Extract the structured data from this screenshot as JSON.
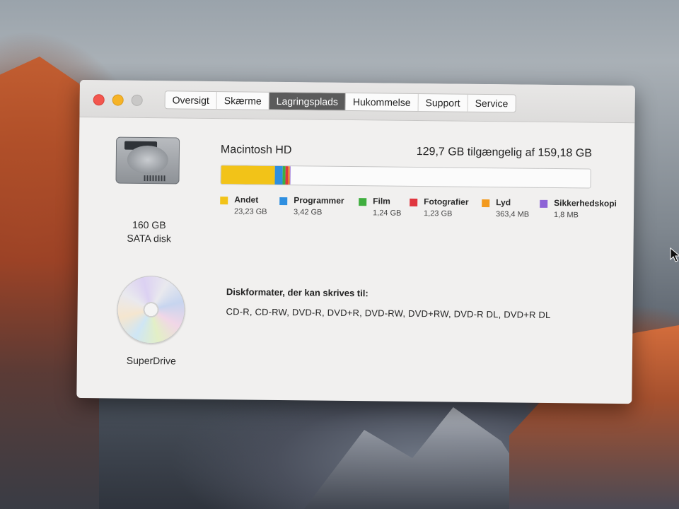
{
  "tabs": [
    "Oversigt",
    "Skærme",
    "Lagringsplads",
    "Hukommelse",
    "Support",
    "Service"
  ],
  "active_tab": "Lagringsplads",
  "disks": {
    "hdd": {
      "size": "160 GB",
      "type": "SATA disk"
    },
    "optical": {
      "name": "SuperDrive"
    }
  },
  "volume": {
    "name": "Macintosh HD",
    "available_text": "129,7 GB tilgængelig af 159,18 GB",
    "total_gb": 159.18,
    "available_gb": 129.7
  },
  "storage_categories": [
    {
      "name": "Andet",
      "size": "23,23 GB",
      "gb": 23.23,
      "color": "#f2c318"
    },
    {
      "name": "Programmer",
      "size": "3,42 GB",
      "gb": 3.42,
      "color": "#2f8fe0"
    },
    {
      "name": "Film",
      "size": "1,24 GB",
      "gb": 1.24,
      "color": "#3fae3f"
    },
    {
      "name": "Fotografier",
      "size": "1,23 GB",
      "gb": 1.23,
      "color": "#e0363f"
    },
    {
      "name": "Lyd",
      "size": "363,4 MB",
      "gb": 0.3634,
      "color": "#f39a1e"
    },
    {
      "name": "Sikkerhedskopi",
      "size": "1,8 MB",
      "gb": 0.0018,
      "color": "#8d63d6"
    }
  ],
  "optical_formats": {
    "title": "Diskformater, der kan skrives til:",
    "list": "CD-R, CD-RW, DVD-R, DVD+R, DVD-RW, DVD+RW, DVD-R DL, DVD+R DL"
  },
  "icons": {
    "close": "close-button",
    "minimize": "minimize-button",
    "zoom": "zoom-button",
    "hdd": "hard-disk-icon",
    "optical": "cd-icon",
    "cursor": "mouse-cursor"
  }
}
